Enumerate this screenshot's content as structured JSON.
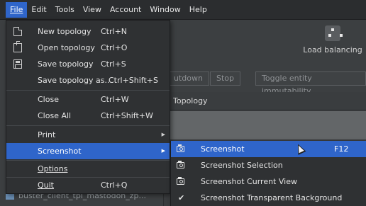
{
  "menubar": {
    "items": [
      {
        "label": "File",
        "active": true
      },
      {
        "label": "Edit",
        "active": false
      },
      {
        "label": "Tools",
        "active": false
      },
      {
        "label": "View",
        "active": false
      },
      {
        "label": "Account",
        "active": false
      },
      {
        "label": "Window",
        "active": false
      },
      {
        "label": "Help",
        "active": false
      }
    ]
  },
  "background": {
    "load_balancing": "Load balancing",
    "toolbar_buttons": [
      "utdown",
      "Stop",
      "Toggle entity immutability"
    ],
    "tab_label": "Topology",
    "list_item": "buster_client_tpi_mastodon_zp..."
  },
  "file_menu": {
    "items": [
      {
        "label": "New topology",
        "shortcut": "Ctrl+N",
        "icon": "new-file-icon"
      },
      {
        "label": "Open topology",
        "shortcut": "Ctrl+O",
        "icon": "open-file-icon"
      },
      {
        "label": "Save topology",
        "shortcut": "Ctrl+S",
        "icon": "save-icon"
      },
      {
        "label": "Save topology as...",
        "shortcut": "Ctrl+Shift+S"
      },
      {
        "label": "Close",
        "shortcut": "Ctrl+W"
      },
      {
        "label": "Close All",
        "shortcut": "Ctrl+Shift+W"
      },
      {
        "label": "Print",
        "submenu": true
      },
      {
        "label": "Screenshot",
        "submenu": true,
        "highlighted": true
      },
      {
        "label": "Options"
      },
      {
        "label": "Quit",
        "shortcut": "Ctrl+Q"
      }
    ]
  },
  "screenshot_submenu": {
    "items": [
      {
        "label": "Screenshot",
        "shortcut": "F12",
        "icon": "camera-icon",
        "highlighted": true
      },
      {
        "label": "Screenshot Selection",
        "icon": "camera-icon"
      },
      {
        "label": "Screenshot Current View",
        "icon": "camera-icon"
      },
      {
        "label": "Screenshot Transparent Background",
        "icon": "checkmark-icon",
        "checked": true
      }
    ]
  },
  "colors": {
    "highlight": "#2f65ca",
    "menu_bg": "#2f3133",
    "window_bg": "#3c3f41"
  }
}
